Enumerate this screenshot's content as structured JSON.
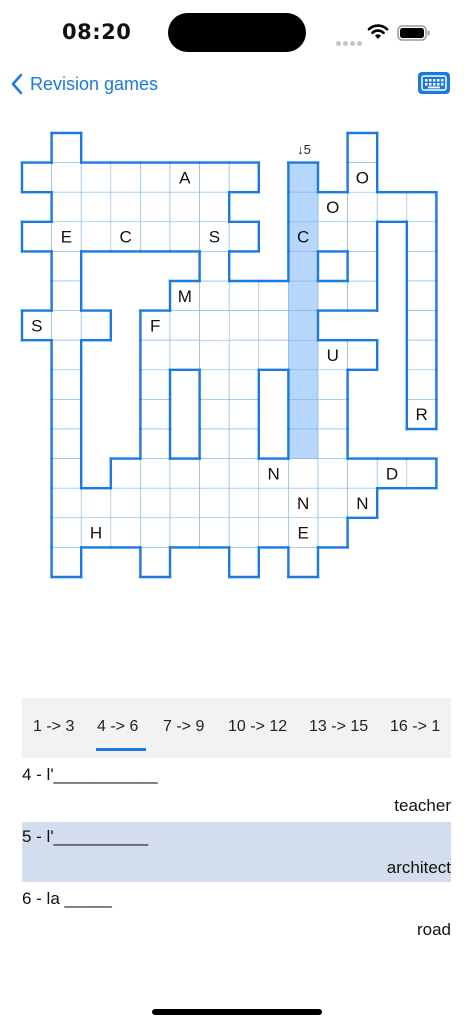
{
  "status": {
    "time": "08:20"
  },
  "nav": {
    "back_label": "Revision games"
  },
  "crossword": {
    "clue_marker": "↓5",
    "colors": {
      "border": "#1a7ae0",
      "selected": "#b7d6fb",
      "line": "#7fb3ee"
    }
  },
  "tabs": [
    {
      "label": "1 -> 3"
    },
    {
      "label": "4 -> 6"
    },
    {
      "label": "7 -> 9"
    },
    {
      "label": "10 -> 12"
    },
    {
      "label": "13 -> 15"
    },
    {
      "label": "16 -> 1"
    }
  ],
  "clues": [
    {
      "prompt": "4 -  l'___________",
      "answer": "teacher"
    },
    {
      "prompt": "5 -  l'__________",
      "answer": "architect"
    },
    {
      "prompt": "6 -  la _____",
      "answer": "road"
    }
  ]
}
